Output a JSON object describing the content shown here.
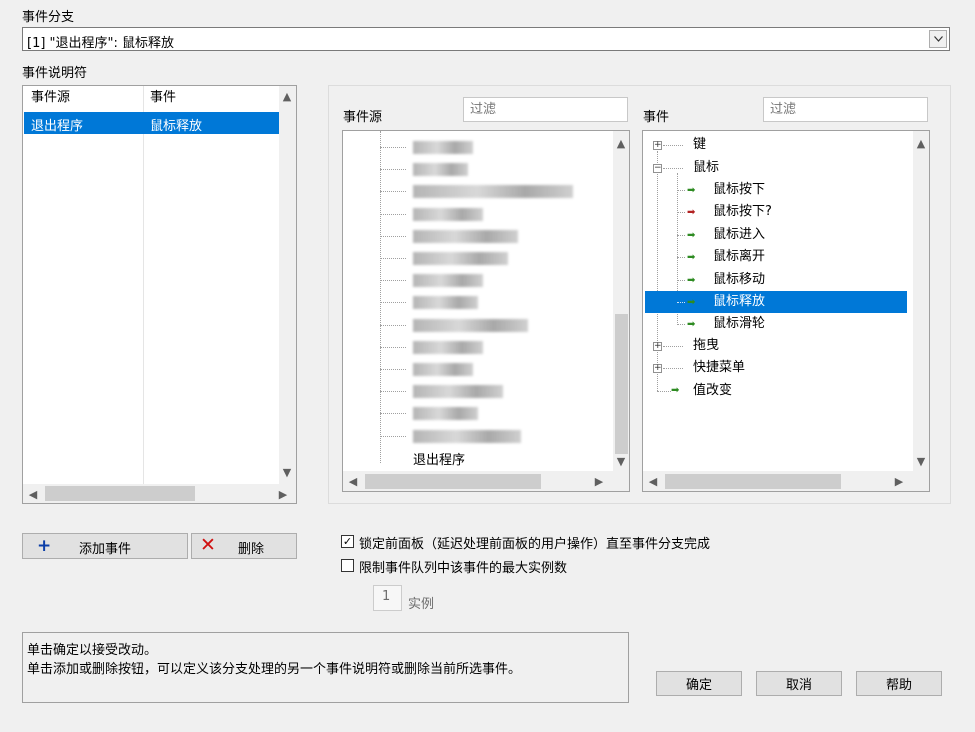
{
  "event_case": {
    "label": "事件分支",
    "selected": "[1] \"退出程序\": 鼠标释放"
  },
  "specifiers": {
    "label": "事件说明符",
    "col_source": "事件源",
    "col_event": "事件",
    "rows": [
      {
        "source": "退出程序",
        "event": "鼠标释放"
      }
    ]
  },
  "source_panel": {
    "label": "事件源",
    "filter_placeholder": "过滤",
    "last_item": "退出程序"
  },
  "event_panel": {
    "label": "事件",
    "filter_placeholder": "过滤",
    "items": {
      "key": "键",
      "mouse": "鼠标",
      "mouse_down": "鼠标按下",
      "mouse_down_filter": "鼠标按下?",
      "mouse_enter": "鼠标进入",
      "mouse_leave": "鼠标离开",
      "mouse_move": "鼠标移动",
      "mouse_up": "鼠标释放",
      "mouse_wheel": "鼠标滑轮",
      "drag": "拖曳",
      "shortcut_menu": "快捷菜单",
      "value_change": "值改变"
    }
  },
  "buttons": {
    "add_event": "添加事件",
    "delete": "删除",
    "ok": "确定",
    "cancel": "取消",
    "help": "帮助"
  },
  "options": {
    "lock_front_panel": "锁定前面板（延迟处理前面板的用户操作）直至事件分支完成",
    "lock_checked": true,
    "limit_queue": "限制事件队列中该事件的最大实例数",
    "limit_checked": false,
    "instances_value": "1",
    "instances_label": "实例"
  },
  "help_text": {
    "line1": "单击确定以接受改动。",
    "line2": "单击添加或删除按钮，可以定义该分支处理的另一个事件说明符或删除当前所选事件。"
  },
  "colors": {
    "selection": "#0078d7",
    "arrow_green": "#2e8b22",
    "arrow_red": "#b22222"
  }
}
